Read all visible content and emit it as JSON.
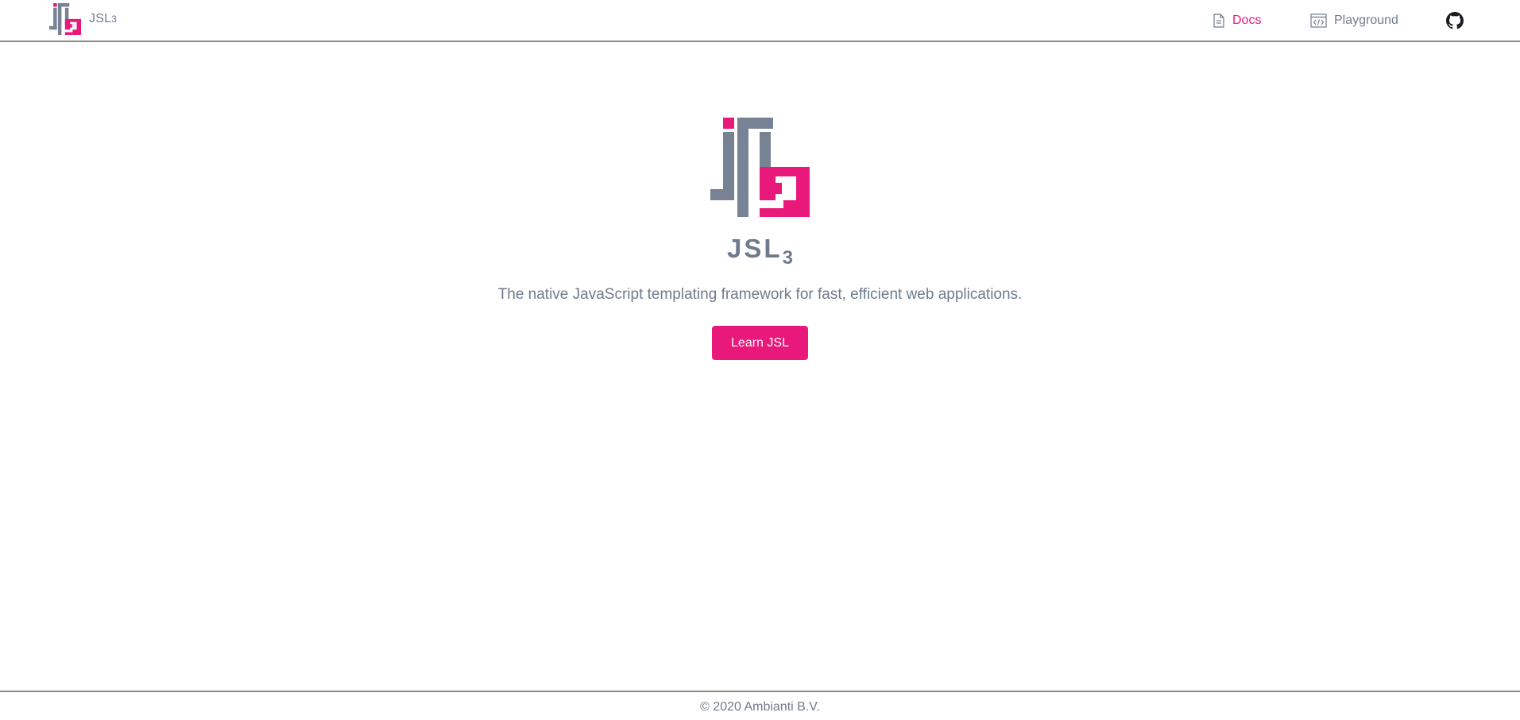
{
  "header": {
    "brand_name": "JSL",
    "brand_sub": "3",
    "nav": {
      "docs_label": "Docs",
      "playground_label": "Playground"
    },
    "icons": {
      "docs": "document-icon",
      "playground": "code-window-icon",
      "github": "github-icon"
    }
  },
  "hero": {
    "title": "JSL",
    "title_sub": "3",
    "tagline": "The native JavaScript templating framework for fast, efficient web applications.",
    "cta_label": "Learn JSL"
  },
  "footer": {
    "copyright": "© 2020 Ambianti B.V."
  },
  "colors": {
    "accent": "#e8197a",
    "slate": "#6f7b8c",
    "logo_gray": "#778394"
  }
}
